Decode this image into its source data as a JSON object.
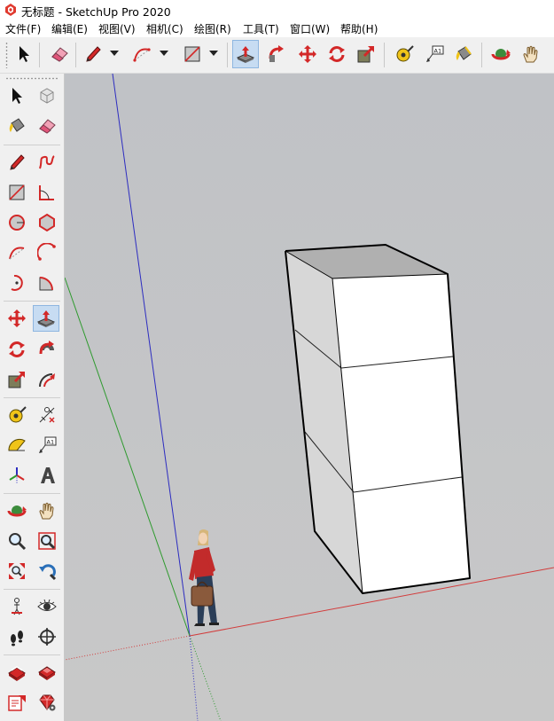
{
  "window": {
    "title": "无标题 - SketchUp Pro 2020"
  },
  "menu": [
    {
      "id": "file",
      "label": "文件(F)"
    },
    {
      "id": "edit",
      "label": "编辑(E)"
    },
    {
      "id": "view",
      "label": "视图(V)"
    },
    {
      "id": "camera",
      "label": "相机(C)"
    },
    {
      "id": "draw",
      "label": "绘图(R)"
    },
    {
      "id": "tools",
      "label": "工具(T)"
    },
    {
      "id": "window",
      "label": "窗口(W)"
    },
    {
      "id": "help",
      "label": "帮助(H)"
    }
  ],
  "toolbar": {
    "tools": [
      "select",
      "eraser",
      "pencil",
      "arc",
      "rectangle",
      "push-pull",
      "follow-me",
      "move",
      "rotate",
      "scale",
      "tape-measure",
      "text",
      "paint-bucket",
      "orbit",
      "pan"
    ],
    "active_tool": "push-pull"
  },
  "tool_palette": {
    "tools": [
      "select",
      "component",
      "paint-bucket",
      "eraser",
      "line",
      "freehand",
      "rectangle",
      "rotated-rectangle",
      "circle",
      "polygon",
      "arc",
      "2-point-arc",
      "3-point-arc",
      "pie",
      "move",
      "push-pull",
      "rotate",
      "follow-me",
      "scale",
      "offset",
      "tape-measure",
      "dimension",
      "protractor",
      "text",
      "axes",
      "3d-text",
      "orbit",
      "pan",
      "zoom",
      "zoom-window",
      "zoom-extents",
      "previous-view",
      "position-camera",
      "look-around",
      "walk",
      "section-plane",
      "warehouse",
      "extension-warehouse",
      "layout",
      "extension-manager"
    ],
    "active_tool": "push-pull"
  },
  "colors": {
    "axis_red": "#d23c3c",
    "axis_green": "#2e9a2e",
    "axis_blue": "#2c2cc0",
    "face_front": "#ffffff",
    "face_side": "#d7d7d7",
    "face_top": "#b0b0b0",
    "sky": "#c2c4c8",
    "ground": "#c9c9c9",
    "active_highlight": "#c7dcf2"
  },
  "scene": {
    "model": "stacked-boxes",
    "box_count": 3,
    "figure": "scale-figure-woman"
  }
}
